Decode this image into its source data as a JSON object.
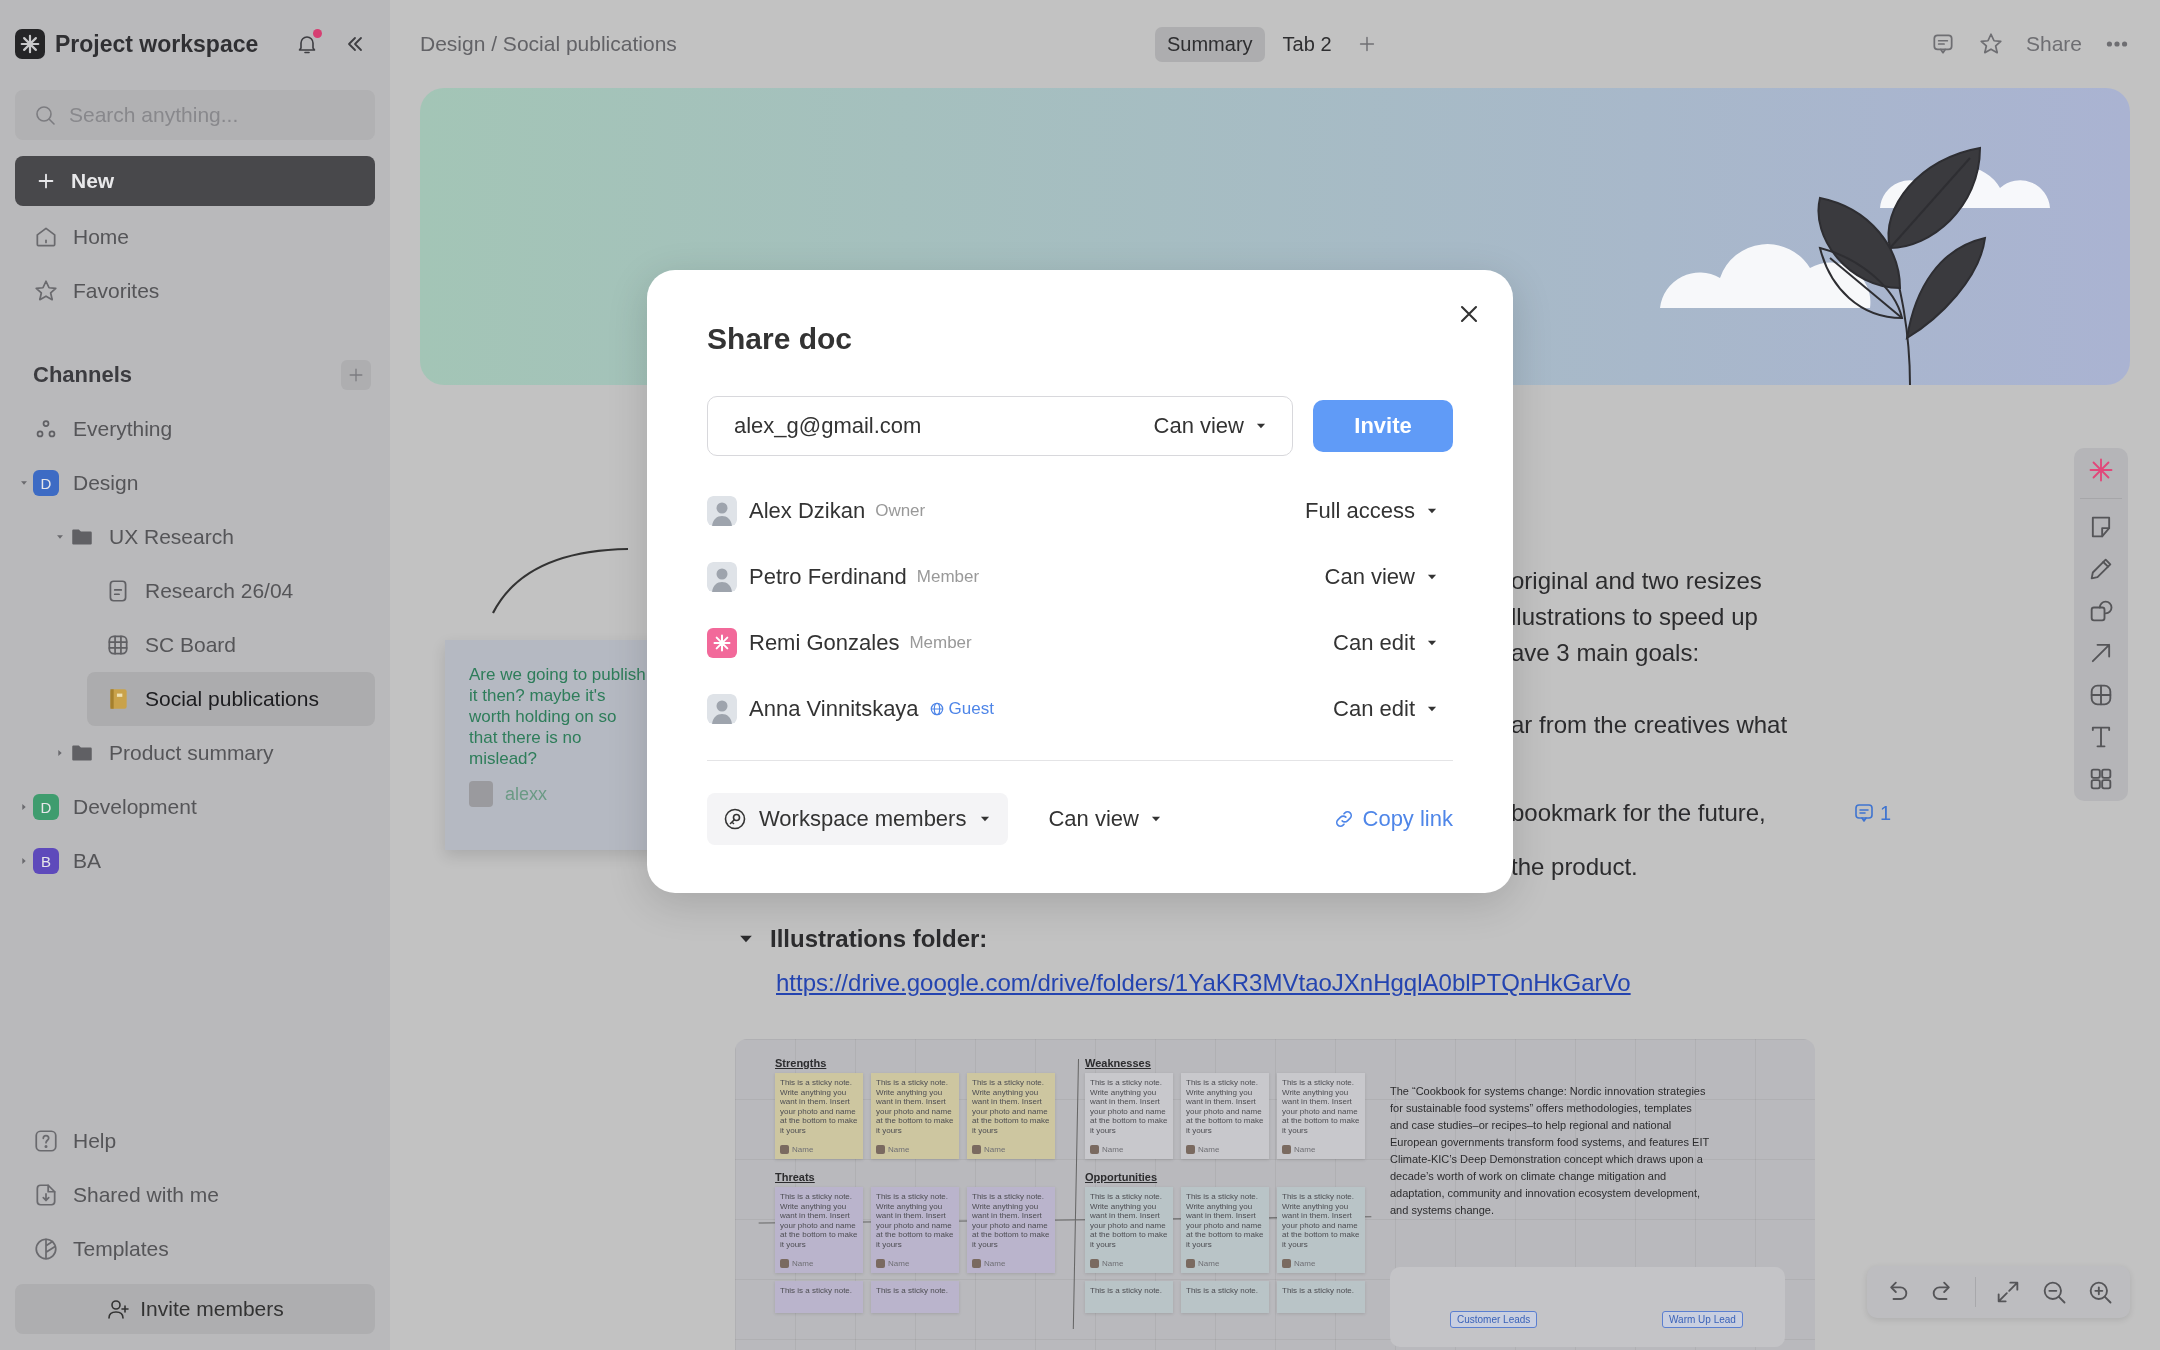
{
  "workspace": {
    "name": "Project workspace",
    "unread": true
  },
  "search": {
    "placeholder": "Search anything..."
  },
  "new_button": "New",
  "nav": [
    {
      "label": "Home",
      "kind": "home"
    },
    {
      "label": "Favorites",
      "kind": "star"
    }
  ],
  "channels": {
    "title": "Channels",
    "items": [
      {
        "label": "Everything",
        "kind": "all",
        "selected": false
      },
      {
        "label": "Design",
        "kind": "space",
        "badge": "D",
        "color": "#3d6bc4",
        "expanded": true,
        "selected": false,
        "children": [
          {
            "label": "UX Research",
            "kind": "folder",
            "expanded": true,
            "selected": false,
            "children": [
              {
                "label": "Research 26/04",
                "kind": "doc",
                "selected": false
              },
              {
                "label": "SC Board",
                "kind": "board",
                "selected": false
              },
              {
                "label": "Social publications",
                "kind": "page",
                "selected": true
              }
            ]
          },
          {
            "label": "Product summary",
            "kind": "folder",
            "expanded": false,
            "selected": false
          }
        ]
      },
      {
        "label": "Development",
        "kind": "space",
        "badge": "D",
        "color": "#3f9c6e",
        "expanded": false,
        "selected": false
      },
      {
        "label": "BA",
        "kind": "space",
        "badge": "B",
        "color": "#5e4abb",
        "expanded": false,
        "selected": false
      }
    ]
  },
  "footer_nav": [
    {
      "label": "Help",
      "kind": "help"
    },
    {
      "label": "Shared with me",
      "kind": "shared"
    },
    {
      "label": "Templates",
      "kind": "templates"
    }
  ],
  "invite_button": "Invite members",
  "topbar": {
    "breadcrumb": "Design / Social publications",
    "tabs": [
      {
        "label": "Summary",
        "selected": true
      },
      {
        "label": "Tab 2",
        "selected": false
      }
    ],
    "share": "Share"
  },
  "document": {
    "comment_card": {
      "text": "Are we going to publish it then? maybe it's worth holding on so that there is no mislead?",
      "author": "alexx"
    },
    "text_fragments": [
      "original and two resizes",
      "llustrations to speed up",
      "ave 3 main goals:",
      "ar from the creatives what",
      "bookmark for the future,",
      "the product."
    ],
    "comment_count": "1",
    "section": {
      "title": "Illustrations folder:",
      "expanded": true,
      "link": "https://drive.google.com/drive/folders/1YaKR3MVtaoJXnHgqlA0blPTQnHkGarVo"
    },
    "board": {
      "quadrants": [
        {
          "title": "Strengths",
          "color": "#cdc6a0",
          "notes": [
            {
              "text": "This is a sticky note. Write anything you want in them. Insert your photo and name at the bottom to make it yours",
              "author": "Name"
            },
            {
              "text": "This is a sticky note. Write anything you want in them. Insert your photo and name at the bottom to make it yours",
              "author": "Name"
            },
            {
              "text": "This is a sticky note. Write anything you want in them. Insert your photo and name at the bottom to make it yours",
              "author": "Name"
            }
          ]
        },
        {
          "title": "Weaknesses",
          "color": "#c8c8cc",
          "notes": [
            {
              "text": "This is a sticky note. Write anything you want in them. Insert your photo and name at the bottom to make it yours",
              "author": "Name"
            },
            {
              "text": "This is a sticky note. Write anything you want in them. Insert your photo and name at the bottom to make it yours",
              "author": "Name"
            },
            {
              "text": "This is a sticky note. Write anything you want in them. Insert your photo and name at the bottom to make it yours",
              "author": "Name"
            }
          ]
        },
        {
          "title": "Threats",
          "color": "#bab4cc",
          "notes": [
            {
              "text": "This is a sticky note. Write anything you want in them. Insert your photo and name at the bottom to make it yours",
              "author": "Name"
            },
            {
              "text": "This is a sticky note. Write anything you want in them. Insert your photo and name at the bottom to make it yours",
              "author": "Name"
            },
            {
              "text": "This is a sticky note. Write anything you want in them. Insert your photo and name at the bottom to make it yours",
              "author": "Name"
            },
            {
              "text": "This is a sticky note."
            },
            {
              "text": "This is a sticky note."
            }
          ]
        },
        {
          "title": "Opportunities",
          "color": "#b9c4c7",
          "notes": [
            {
              "text": "This is a sticky note. Write anything you want in them. Insert your photo and name at the bottom to make it yours",
              "author": "Name"
            },
            {
              "text": "This is a sticky note. Write anything you want in them. Insert your photo and name at the bottom to make it yours",
              "author": "Name"
            },
            {
              "text": "This is a sticky note. Write anything you want in them. Insert your photo and name at the bottom to make it yours",
              "author": "Name"
            },
            {
              "text": "This is a sticky note."
            },
            {
              "text": "This is a sticky note."
            },
            {
              "text": "This is a sticky note."
            }
          ]
        }
      ],
      "paragraph": "The “Cookbook for systems change: Nordic innovation strategies for sustainable food systems” offers methodologies, templates and case studies–or recipes–to help regional and national European governments transform food systems, and features EIT Climate-KIC’s Deep Demonstration concept which draws upon a decade’s worth of work on climate change mitigation and adaptation, community and innovation ecosystem development, and systems change.",
      "mind_map_nodes": [
        "Customer Leads",
        "Warm Up Lead"
      ]
    }
  },
  "modal": {
    "title": "Share doc",
    "email": "alex_g@gmail.com",
    "email_permission": "Can view",
    "invite": "Invite",
    "members": [
      {
        "name": "Alex Dzikan",
        "role": "Owner",
        "guest": false,
        "kind": "photo",
        "permission": "Full access"
      },
      {
        "name": "Petro Ferdinand",
        "role": "Member",
        "guest": false,
        "kind": "photo",
        "permission": "Can view"
      },
      {
        "name": "Remi Gonzales",
        "role": "Member",
        "guest": false,
        "kind": "logo",
        "permission": "Can edit"
      },
      {
        "name": "Anna Vinnitskaya",
        "role": "Guest",
        "guest": true,
        "kind": "photo",
        "permission": "Can edit"
      }
    ],
    "link_scope": "Workspace members",
    "link_permission": "Can view",
    "copy_link": "Copy link"
  }
}
